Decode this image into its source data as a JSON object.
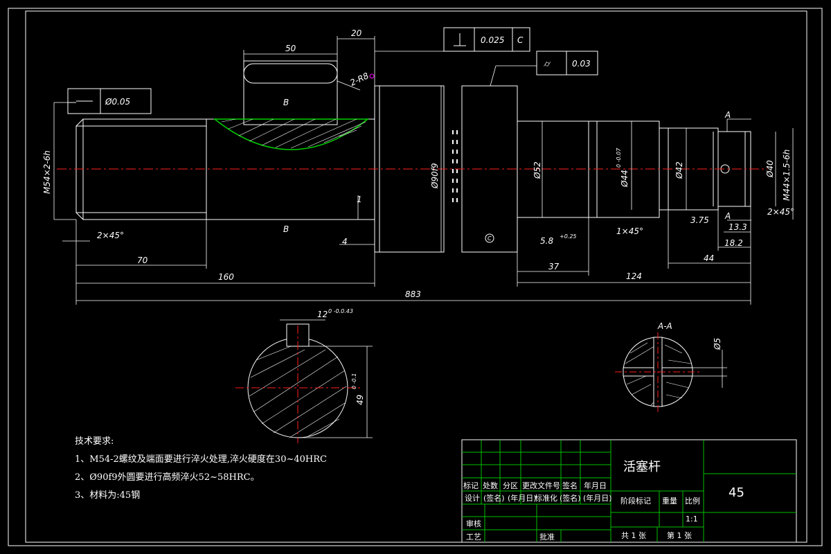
{
  "colors": {
    "background": "#000000",
    "outline": "#ffffff",
    "centerline": "#ff2020",
    "title_grid": "#00c000",
    "hatch_boundary": "#00d000",
    "magenta": "#ff00ff"
  },
  "dims": {
    "d50": "50",
    "d20": "20",
    "perp_tol": "0.025",
    "datum_c": "C",
    "runout_tol": "0.03",
    "flat_tol": "Ø0.05",
    "r2": "2-R8",
    "thread_left": "M54×2-6h",
    "dia90": "Ø90f9",
    "dia52": "Ø52",
    "dia44": "Ø44",
    "dia44_tol": "0\n-0.07",
    "dia42": "Ø42",
    "dia40": "Ø40",
    "thread_right": "M44×1.5-6h",
    "ch_left": "2×45°",
    "d70": "70",
    "d160": "160",
    "d883": "883",
    "d4": "4",
    "d1": "1",
    "d58": "5.8",
    "d58_tol": "+0.25\n0",
    "ch_mid": "1×45°",
    "d375": "3.75",
    "d37": "37",
    "d124": "124",
    "d133": "13.3",
    "d182": "18.2",
    "d44len": "44",
    "ch_right": "2×45°",
    "sec_b": "B",
    "sec_a": "A",
    "datum_c_circle": "C"
  },
  "section_b": {
    "key_width": "12",
    "key_tol": "0\n-0.043",
    "depth": "49",
    "depth_tol": "0\n-0.1"
  },
  "section_a": {
    "label": "A-A",
    "hole": "Ø5"
  },
  "notes": {
    "title": "技术要求:",
    "line1": "1、M54-2螺纹及端面要进行淬火处理,淬火硬度在30~40HRC",
    "line2": "2、Ø90f9外圆要进行高频淬火52~58HRC。",
    "line3": "3、材料为:45钢"
  },
  "title_block": {
    "part_name": "活塞杆",
    "material": "45",
    "h_mark": "标记",
    "h_count": "处数",
    "h_zone": "分区",
    "h_doc": "更改文件号",
    "h_sign": "签名",
    "h_date": "年月日",
    "r_design": "设计",
    "r_sign": "(签名)",
    "r_date": "(年月日)",
    "r_std": "标准化",
    "r_sign2": "(签名)",
    "r_date2": "(年月日)",
    "stage": "阶段标记",
    "weight": "重量",
    "scale_h": "比例",
    "scale": "1:1",
    "review": "审核",
    "process": "工艺",
    "approve": "批准",
    "total": "共 1 张",
    "sheet": "第 1 张"
  }
}
